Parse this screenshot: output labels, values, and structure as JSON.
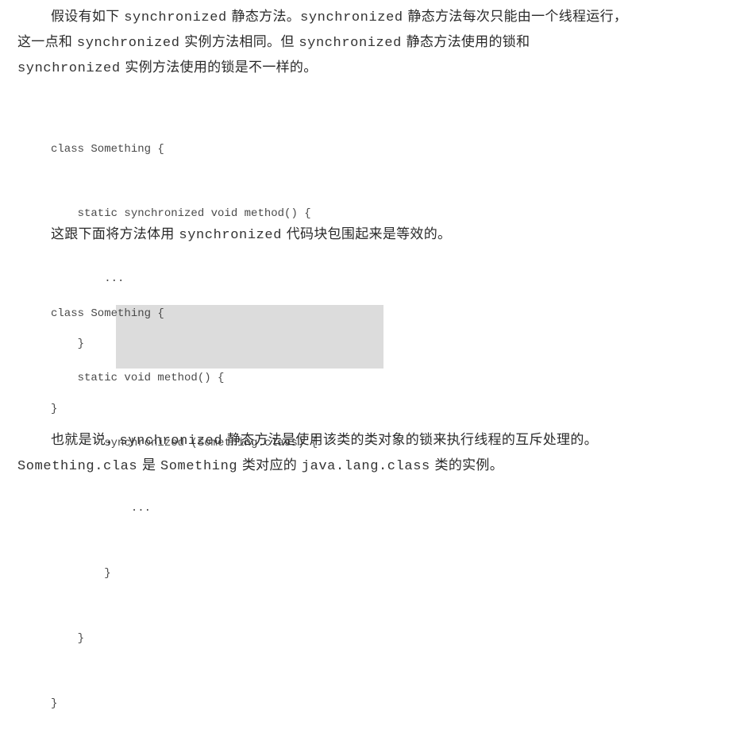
{
  "paragraph1": {
    "line1": {
      "a": "假设有如下 ",
      "b": "synchronized",
      "c": " 静态方法。",
      "d": "synchronized",
      "e": " 静态方法每次只能由一个线程运行，"
    },
    "line2": {
      "a": "这一点和 ",
      "b": "synchronized",
      "c": " 实例方法相同。但 ",
      "d": "synchronized",
      "e": " 静态方法使用的锁和"
    },
    "line3": {
      "a": "synchronized",
      "b": " 实例方法使用的锁是不一样的。"
    }
  },
  "code1": [
    "class Something {",
    "    static synchronized void method() {",
    "        ...",
    "    }",
    "}"
  ],
  "paragraph2": {
    "a": "这跟下面将方法体用 ",
    "b": "synchronized",
    "c": " 代码块包围起来是等效的。"
  },
  "code2": [
    "class Something {",
    "    static void method() {",
    "        synchronized (Something.class) {",
    "            ...",
    "        }",
    "    }",
    "}"
  ],
  "paragraph3": {
    "line1": {
      "a": "也就是说，",
      "b": "synchronized",
      "c": " 静态方法是使用该类的类对象的锁来执行线程的互斥处理的。"
    },
    "line2": {
      "a": "Something.clas",
      "b": " 是 ",
      "c": "Something",
      "d": " 类对应的 ",
      "e": "java.lang.class",
      "f": " 类的实例。"
    }
  }
}
